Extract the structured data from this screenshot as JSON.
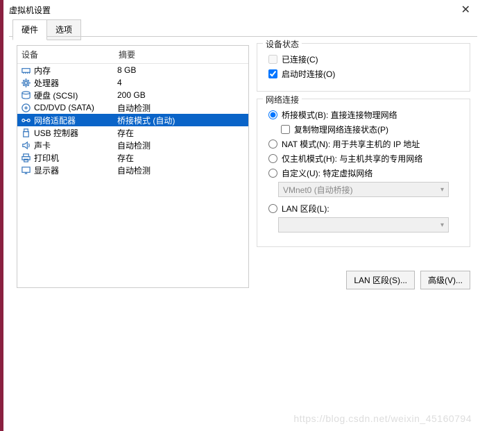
{
  "window": {
    "title": "虚拟机设置",
    "close": "✕"
  },
  "tabs": {
    "hardware": "硬件",
    "options": "选项"
  },
  "device_list": {
    "header_device": "设备",
    "header_summary": "摘要",
    "rows": [
      {
        "icon": "memory",
        "device": "内存",
        "summary": "8 GB"
      },
      {
        "icon": "cpu",
        "device": "处理器",
        "summary": "4"
      },
      {
        "icon": "disk",
        "device": "硬盘 (SCSI)",
        "summary": "200 GB"
      },
      {
        "icon": "cd",
        "device": "CD/DVD (SATA)",
        "summary": "自动检测"
      },
      {
        "icon": "net",
        "device": "网络适配器",
        "summary": "桥接模式 (自动)"
      },
      {
        "icon": "usb",
        "device": "USB 控制器",
        "summary": "存在"
      },
      {
        "icon": "sound",
        "device": "声卡",
        "summary": "自动检测"
      },
      {
        "icon": "printer",
        "device": "打印机",
        "summary": "存在"
      },
      {
        "icon": "display",
        "device": "显示器",
        "summary": "自动检测"
      }
    ],
    "selected_index": 4
  },
  "device_status": {
    "group_title": "设备状态",
    "connected_label": "已连接(C)",
    "connected_checked": false,
    "connect_at_power_label": "启动时连接(O)",
    "connect_at_power_checked": true
  },
  "network": {
    "group_title": "网络连接",
    "bridged_label": "桥接模式(B): 直接连接物理网络",
    "replicate_label": "复制物理网络连接状态(P)",
    "replicate_checked": false,
    "nat_label": "NAT 模式(N): 用于共享主机的 IP 地址",
    "hostonly_label": "仅主机模式(H): 与主机共享的专用网络",
    "custom_label": "自定义(U): 特定虚拟网络",
    "custom_value": "VMnet0 (自动桥接)",
    "lan_label": "LAN 区段(L):",
    "lan_value": "",
    "selected": "bridged"
  },
  "buttons": {
    "lan_segments": "LAN 区段(S)...",
    "advanced": "高级(V)..."
  },
  "watermark": "https://blog.csdn.net/weixin_45160794"
}
